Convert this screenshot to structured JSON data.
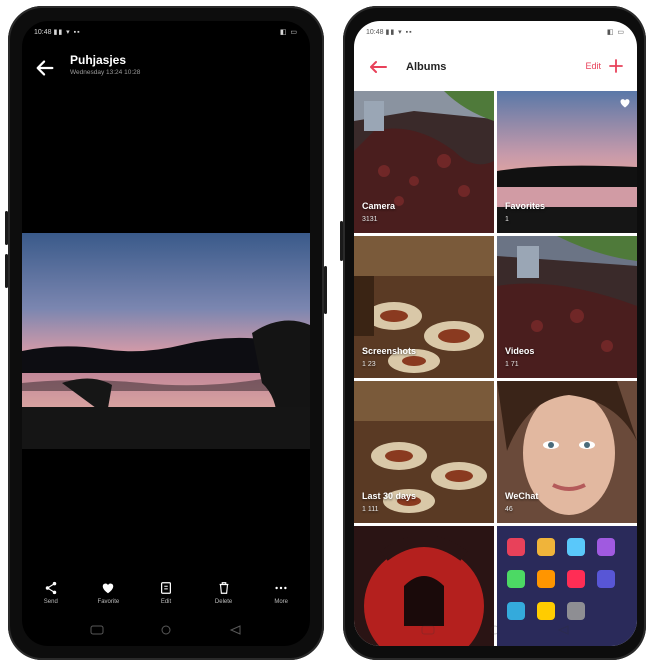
{
  "left_phone": {
    "status": {
      "time": "10:48",
      "icons": "▮▮ ▾ ▪▪",
      "battery": "◧ ▭"
    },
    "header": {
      "title": "Puhjasjes",
      "subtitle": "Wednesday 13:24 10:28"
    },
    "toolbar": [
      {
        "icon": "share-icon",
        "label": "Send"
      },
      {
        "icon": "heart-icon",
        "label": "Favorite"
      },
      {
        "icon": "edit-icon",
        "label": "Edit"
      },
      {
        "icon": "trash-icon",
        "label": "Delete"
      },
      {
        "icon": "more-icon",
        "label": "More"
      }
    ]
  },
  "right_phone": {
    "status": {
      "time": "10:48",
      "icons": "▮▮ ▾ ▪▪",
      "battery": "◧ ▭"
    },
    "header": {
      "title": "Albums",
      "edit_label": "Edit"
    },
    "albums": [
      {
        "name": "Camera",
        "count": "3131"
      },
      {
        "name": "Favorites",
        "count": "1"
      },
      {
        "name": "Screenshots",
        "count": "1 23"
      },
      {
        "name": "Videos",
        "count": "1 71"
      },
      {
        "name": "Last 30 days",
        "count": "1 111"
      },
      {
        "name": "WeChat",
        "count": "46"
      },
      {
        "name": "",
        "count": ""
      },
      {
        "name": "",
        "count": ""
      }
    ]
  },
  "colors": {
    "accent": "#e8415a",
    "dark_bg": "#000000",
    "light_bg": "#ffffff"
  }
}
